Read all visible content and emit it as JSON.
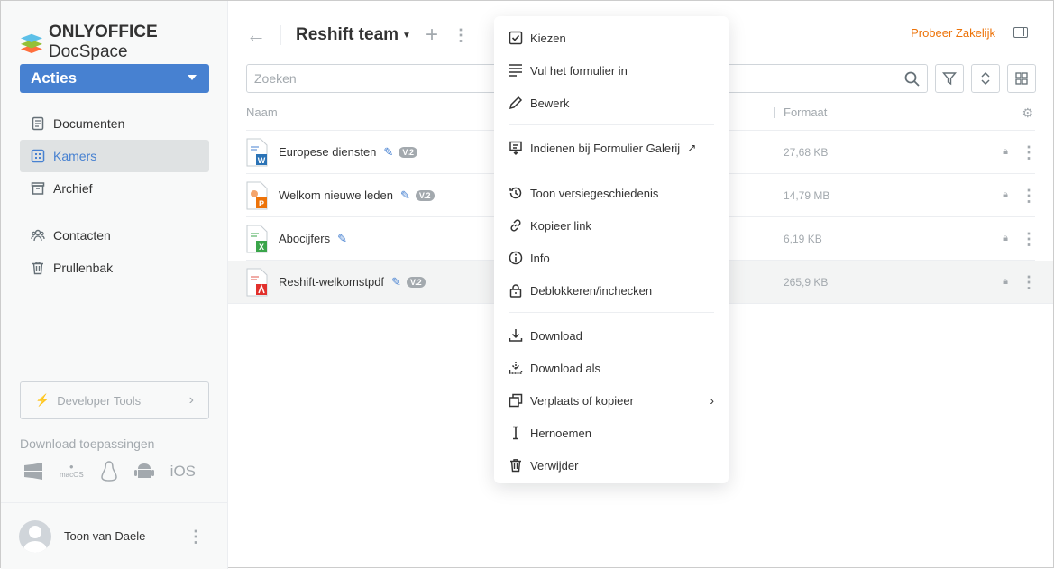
{
  "brand": {
    "name_bold": "ONLYOFFICE",
    "name_light": "DocSpace"
  },
  "sidebar": {
    "actions_label": "Acties",
    "items": [
      {
        "label": "Documenten"
      },
      {
        "label": "Kamers"
      },
      {
        "label": "Archief"
      },
      {
        "label": "Contacten"
      },
      {
        "label": "Prullenbak"
      }
    ],
    "developer_tools": "Developer Tools",
    "download_title": "Download toepassingen",
    "apps": [
      "Windows",
      "macOS",
      "Linux",
      "Android",
      "iOS"
    ],
    "user": "Toon van Daele"
  },
  "header": {
    "title": "Reshift team",
    "try_business": "Probeer Zakelijk"
  },
  "search": {
    "placeholder": "Zoeken"
  },
  "table": {
    "columns": {
      "name": "Naam",
      "size": "Formaat"
    },
    "rows": [
      {
        "name": "Europese diensten",
        "type": "docx",
        "version": "V.2",
        "size": "27,68 KB"
      },
      {
        "name": "Welkom nieuwe leden",
        "type": "pptx",
        "version": "V.2",
        "size": "14,79 MB"
      },
      {
        "name": "Abocijfers",
        "type": "xlsx",
        "version": "",
        "size": "6,19 KB"
      },
      {
        "name": "Reshift-welkomstpdf",
        "type": "pdf",
        "version": "V.2",
        "size": "265,9 KB"
      }
    ]
  },
  "context_menu": {
    "items": [
      "Kiezen",
      "Vul het formulier in",
      "Bewerk",
      "Indienen bij Formulier Galerij",
      "Toon versiegeschiedenis",
      "Kopieer link",
      "Info",
      "Deblokkeren/inchecken",
      "Download",
      "Download als",
      "Verplaats of kopieer",
      "Hernoemen",
      "Verwijder"
    ]
  },
  "colors": {
    "accent": "#4781d1",
    "orange": "#ed7309"
  }
}
